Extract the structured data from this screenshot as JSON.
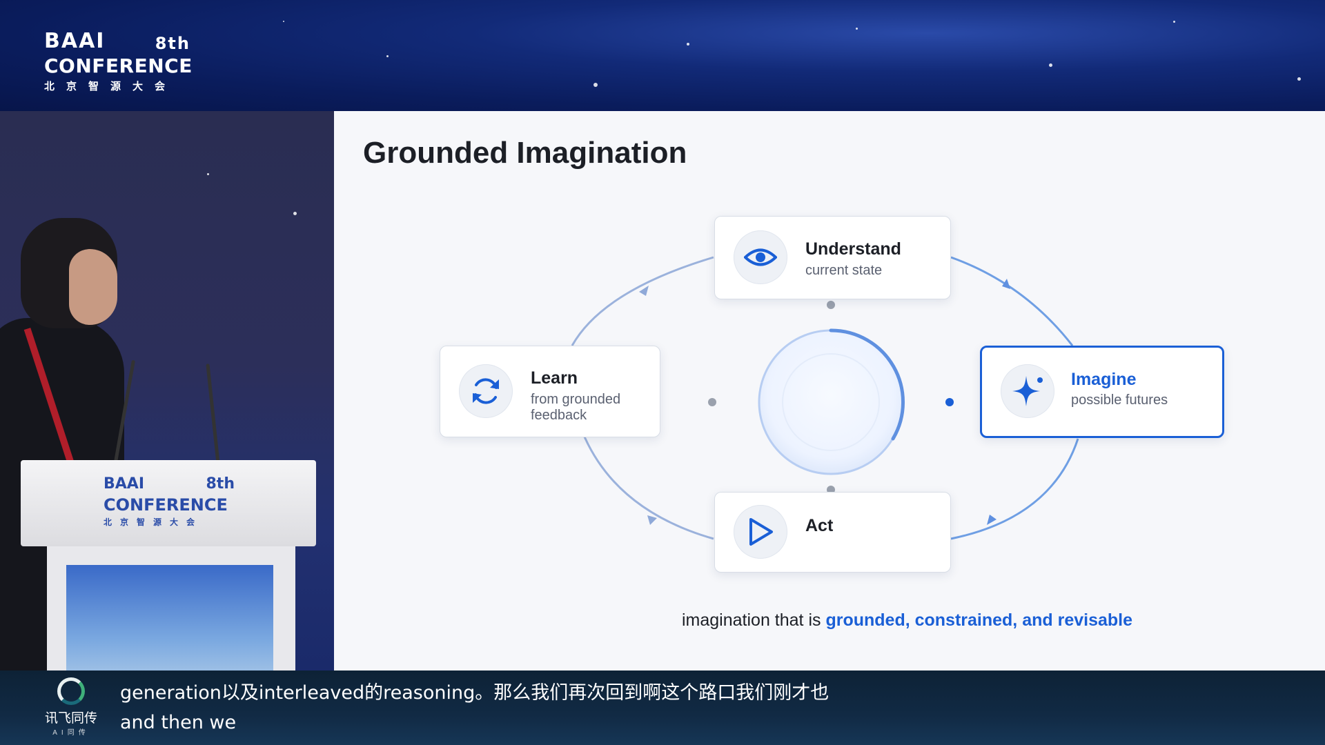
{
  "event_logo": {
    "brand": "BAAI",
    "edition": "8th",
    "conference": "CONFERENCE",
    "cn_name": "北京智源大会"
  },
  "podium_logo": {
    "brand": "BAAI",
    "edition": "8th",
    "conference": "CONFERENCE",
    "cn_name": "北京智源大会"
  },
  "slide": {
    "title": "Grounded Imagination",
    "cards": {
      "understand": {
        "title": "Understand",
        "subtitle": "current state",
        "icon": "eye-icon"
      },
      "imagine": {
        "title": "Imagine",
        "subtitle": "possible futures",
        "icon": "sparkle-icon",
        "active": true
      },
      "act": {
        "title": "Act",
        "subtitle": "",
        "icon": "play-icon"
      },
      "learn": {
        "title": "Learn",
        "subtitle_line1": "from grounded",
        "subtitle_line2": "feedback",
        "icon": "refresh-icon"
      }
    },
    "caption_prefix": "imagination that is ",
    "caption_highlight": "grounded, constrained, and revisable"
  },
  "subtitles": {
    "provider_name": "讯飞同传",
    "provider_tag": "AI同传",
    "line1": "generation以及interleaved的reasoning。那么我们再次回到啊这个路口我们刚才也",
    "line2": "and then we"
  },
  "colors": {
    "accent": "#1a5fd6",
    "ring": "#6f9fe4",
    "banner": "#0a1c5c"
  }
}
